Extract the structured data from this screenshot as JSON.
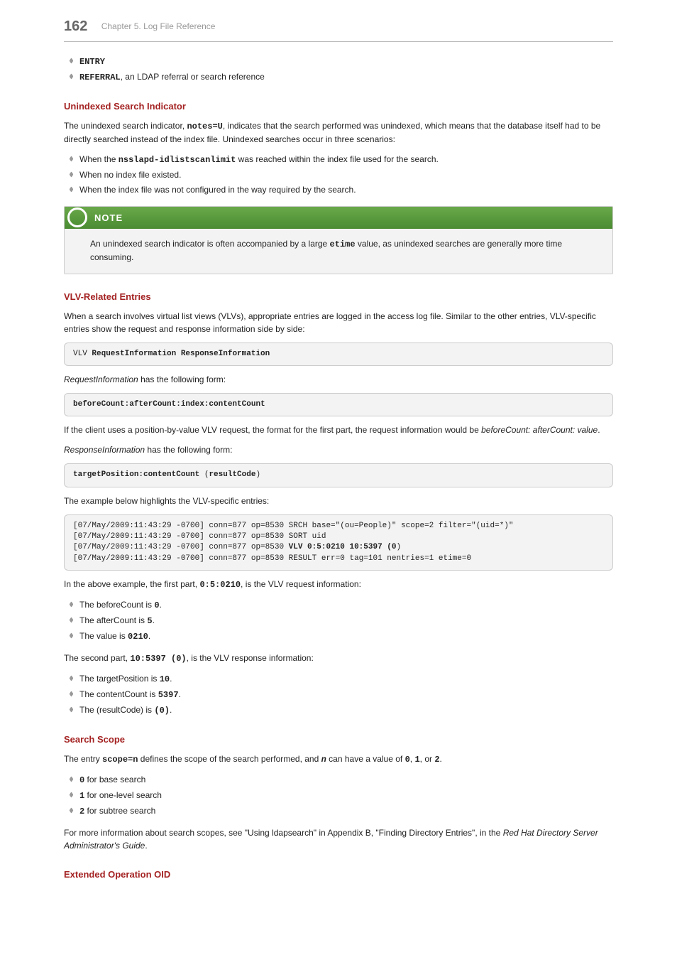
{
  "page": {
    "number": "162",
    "chapter": "Chapter 5. Log File Reference"
  },
  "intro_list": [
    {
      "bold": "ENTRY",
      "rest": ""
    },
    {
      "bold": "REFERRAL",
      "rest": ", an LDAP referral or search reference"
    }
  ],
  "s1": {
    "title": "Unindexed Search Indicator"
  },
  "s1_p1a": "The unindexed search indicator, ",
  "s1_p1b": "notes=U",
  "s1_p1c": ", indicates that the search performed was unindexed, which means that the database itself had to be directly searched instead of the index file. Unindexed searches occur in three scenarios:",
  "s1_l0a": "When the ",
  "s1_l0b": "nsslapd-idlistscanlimit",
  "s1_l0c": " was reached within the index file used for the search.",
  "s1_l1": "When no index file existed.",
  "s1_l2": "When the index file was not configured in the way required by the search.",
  "note": {
    "label": "NOTE",
    "a": "An unindexed search indicator is often accompanied by a large ",
    "b": "etime",
    "c": " value, as unindexed searches are generally more time consuming."
  },
  "s2": {
    "title": "VLV-Related Entries"
  },
  "s2_p1": "When a search involves virtual list views (VLVs), appropriate entries are logged in the access log file. Similar to the other entries, VLV-specific entries show the request and response information side by side:",
  "s2_code1": "VLV RequestInformation ResponseInformation",
  "s2_p2a": "RequestInformation",
  "s2_p2b": " has the following form:",
  "s2_code2": "beforeCount:afterCount:index:contentCount",
  "s2_p3a": "If the client uses a position-by-value VLV request, the format for the first part, the request information would be ",
  "s2_p3b": "beforeCount: afterCount: value",
  "s2_p3c": ".",
  "s2_p4a": "ResponseInformation",
  "s2_p4b": " has the following form:",
  "s2_code3a": "targetPosition:contentCount",
  "s2_code3b": " (",
  "s2_code3c": "resultCode",
  "s2_code3d": ")",
  "s2_p5": "The example below highlights the VLV-specific entries:",
  "s2_codebig": "[07/May/2009:11:43:29 -0700] conn=877 op=8530 SRCH base=\"(ou=People)\" scope=2 filter=\"(uid=*)\"\n[07/May/2009:11:43:29 -0700] conn=877 op=8530 SORT uid\n[07/May/2009:11:43:29 -0700] conn=877 op=8530 VLV 0:5:0210 10:5397 (0)\n[07/May/2009:11:43:29 -0700] conn=877 op=8530 RESULT err=0 tag=101 nentries=1 etime=0",
  "s2_p6a": "In the above example, the first part, ",
  "s2_p6b": "0:5:0210",
  "s2_p6c": ", is the VLV request information:",
  "s2_req0a": "The beforeCount is ",
  "s2_req0b": "0",
  "s2_req0c": ".",
  "s2_req1a": "The afterCount is ",
  "s2_req1b": "5",
  "s2_req1c": ".",
  "s2_req2a": "The value is ",
  "s2_req2b": "0210",
  "s2_req2c": ".",
  "s2_p7a": "The second part, ",
  "s2_p7b": "10:5397 (0)",
  "s2_p7c": ", is the VLV response information:",
  "s2_res0a": "The targetPosition is ",
  "s2_res0b": "10",
  "s2_res0c": ".",
  "s2_res1a": "The contentCount is ",
  "s2_res1b": "5397",
  "s2_res1c": ".",
  "s2_res2a": "The (resultCode) is ",
  "s2_res2b": "(0)",
  "s2_res2c": ".",
  "s3": {
    "title": "Search Scope"
  },
  "s3_p1a": "The entry ",
  "s3_p1b": "scope=n",
  "s3_p1c": " defines the scope of the search performed, and ",
  "s3_p1d": "n",
  "s3_p1e": " can have a value of ",
  "s3_p1f": "0",
  "s3_p1g": ", ",
  "s3_p1h": "1",
  "s3_p1i": ", or ",
  "s3_p1j": "2",
  "s3_p1k": ".",
  "s3_l0a": "0",
  "s3_l0b": " for base search",
  "s3_l1a": "1",
  "s3_l1b": " for one-level search",
  "s3_l2a": "2",
  "s3_l2b": " for subtree search",
  "s3_p2a": "For more information about search scopes, see \"Using ldapsearch\" in Appendix B, \"Finding Directory Entries\", in the ",
  "s3_p2b": "Red Hat Directory Server Administrator's Guide",
  "s3_p2c": ".",
  "s4": {
    "title": "Extended Operation OID"
  }
}
